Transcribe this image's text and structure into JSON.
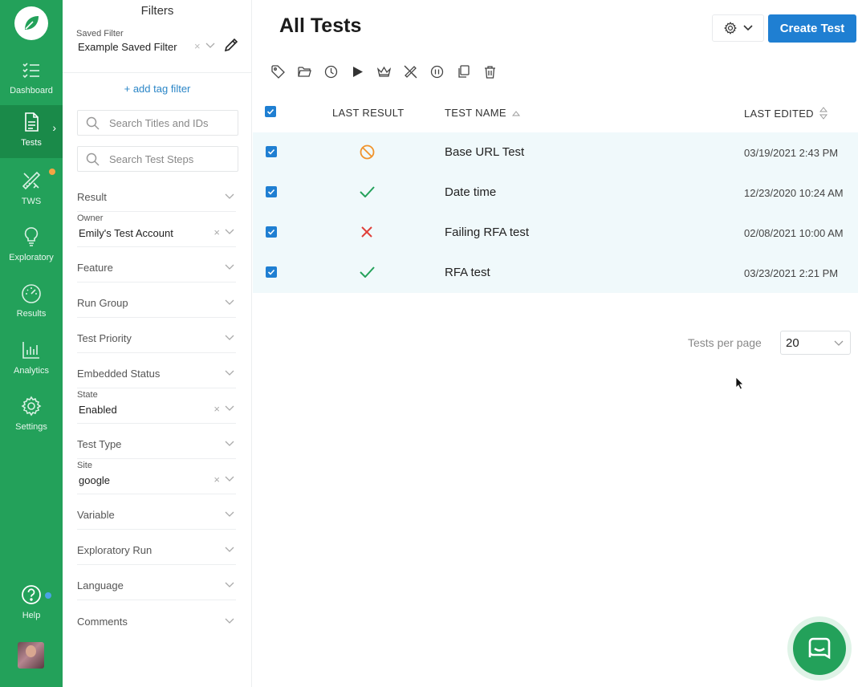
{
  "nav": {
    "items": [
      {
        "label": "Dashboard",
        "icon": "dashboard-icon"
      },
      {
        "label": "Tests",
        "icon": "document-icon"
      },
      {
        "label": "TWS",
        "icon": "tools-icon"
      },
      {
        "label": "Exploratory",
        "icon": "lightbulb-icon"
      },
      {
        "label": "Results",
        "icon": "gauge-icon"
      },
      {
        "label": "Analytics",
        "icon": "bar-chart-icon"
      },
      {
        "label": "Settings",
        "icon": "gear-icon"
      }
    ],
    "help_label": "Help",
    "colors": {
      "rail": "#23a15a",
      "active": "#1a8a49",
      "badge_orange": "#f5a443",
      "badge_blue": "#4aa3e6"
    }
  },
  "filters": {
    "title": "Filters",
    "saved_filter_label": "Saved Filter",
    "saved_filter_value": "Example Saved Filter",
    "add_tag": "+ add tag filter",
    "search_titles_placeholder": "Search Titles and IDs",
    "search_steps_placeholder": "Search Test Steps",
    "rows": [
      {
        "name": "Result"
      },
      {
        "small": "Owner",
        "value": "Emily's Test Account"
      },
      {
        "name": "Feature"
      },
      {
        "name": "Run Group"
      },
      {
        "name": "Test Priority"
      },
      {
        "name": "Embedded Status"
      },
      {
        "small": "State",
        "value": "Enabled"
      },
      {
        "name": "Test Type"
      },
      {
        "small": "Site",
        "value": "google"
      },
      {
        "name": "Variable"
      },
      {
        "name": "Exploratory Run"
      },
      {
        "name": "Language"
      },
      {
        "name": "Comments"
      }
    ]
  },
  "main": {
    "title": "All Tests",
    "create_button": "Create Test",
    "toolbar": [
      "tag-icon",
      "folder-icon",
      "clock-icon",
      "play-icon",
      "crown-icon",
      "tools-off-icon",
      "pause-icon",
      "copy-icon",
      "trash-icon"
    ],
    "columns": {
      "result": "LAST RESULT",
      "name": "TEST NAME",
      "edited": "LAST EDITED"
    },
    "rows": [
      {
        "result": "blocked",
        "name": "Base URL Test",
        "edited": "03/19/2021 2:43 PM"
      },
      {
        "result": "passed",
        "name": "Date time",
        "edited": "12/23/2020 10:24 AM"
      },
      {
        "result": "failed",
        "name": "Failing RFA test",
        "edited": "02/08/2021 10:00 AM"
      },
      {
        "result": "passed",
        "name": "RFA test",
        "edited": "03/23/2021 2:21 PM"
      }
    ],
    "pager": {
      "label": "Tests per page",
      "value": "20"
    },
    "colors": {
      "accent": "#1f7fd2",
      "row_bg": "#f0f9fb",
      "pass": "#23a15a",
      "fail": "#e0403a",
      "blocked": "#f0932b"
    }
  }
}
